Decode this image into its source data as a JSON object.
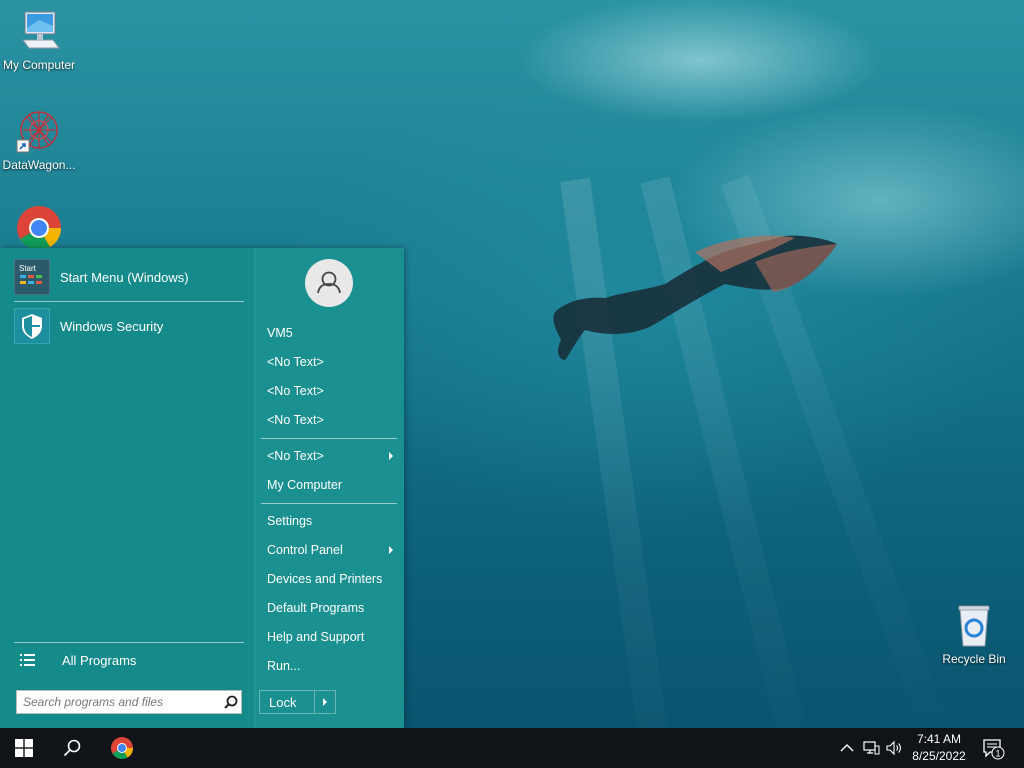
{
  "desktop": {
    "icons": [
      {
        "label": "My Computer",
        "icon": "computer-icon"
      },
      {
        "label": "DataWagon...",
        "icon": "datawagon-icon"
      },
      {
        "label": "",
        "icon": "chrome-icon"
      },
      {
        "label": "Recycle Bin",
        "icon": "recycle-bin-icon"
      }
    ]
  },
  "start_menu": {
    "pinned": [
      {
        "label": "Start Menu (Windows)",
        "icon": "start-menu-app-icon",
        "icon_text": "Start"
      },
      {
        "label": "Windows Security",
        "icon": "shield-icon"
      }
    ],
    "all_programs_label": "All Programs",
    "search": {
      "placeholder": "Search programs and files"
    },
    "user": {
      "icon": "user-avatar-icon"
    },
    "right_items": [
      {
        "label": "VM5",
        "submenu": false
      },
      {
        "label": "<No Text>",
        "submenu": false
      },
      {
        "label": "<No Text>",
        "submenu": false
      },
      {
        "label": "<No Text>",
        "submenu": false
      },
      {
        "label": "<No Text>",
        "submenu": true
      },
      {
        "label": "My Computer",
        "submenu": false
      },
      {
        "label": "Settings",
        "submenu": false
      },
      {
        "label": "Control Panel",
        "submenu": true
      },
      {
        "label": "Devices and Printers",
        "submenu": false
      },
      {
        "label": "Default Programs",
        "submenu": false
      },
      {
        "label": "Help and Support",
        "submenu": false
      },
      {
        "label": "Run...",
        "submenu": false
      }
    ],
    "lock_label": "Lock"
  },
  "taskbar": {
    "buttons": [
      "windows-start-icon",
      "search-icon",
      "chrome-icon"
    ],
    "tray_icons": [
      "chevron-up-icon",
      "network-icon",
      "volume-icon"
    ],
    "time": "7:41 AM",
    "date": "8/25/2022",
    "notification_count": "1"
  },
  "colors": {
    "start_menu_bg": "#158a8a",
    "taskbar_bg": "#101418"
  }
}
